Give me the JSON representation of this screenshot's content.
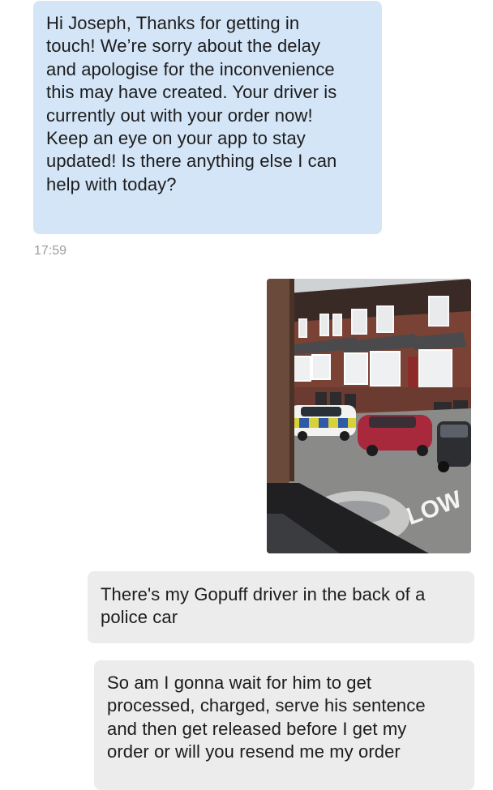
{
  "conversation": {
    "messages": [
      {
        "direction": "incoming",
        "lines": [
          "Hi Joseph, Thanks for getting in",
          "touch! We’re sorry about the delay",
          "and apologise for the inconvenience",
          "this may have created. Your driver is",
          "currently out with your order now!",
          "Keep an eye on your app to stay",
          "updated! Is there anything else I can",
          "help with today?"
        ]
      },
      {
        "direction": "outgoing",
        "lines": [
          "There's my Gopuff driver in the back of a",
          "police car"
        ]
      },
      {
        "direction": "outgoing",
        "lines": [
          "So am I gonna wait for him to get",
          "processed, charged, serve his sentence",
          "and then get released before I get my",
          "order or will you resend me my order"
        ]
      }
    ],
    "timestamp": "17:59",
    "photo": {
      "road_marking": "SLOW",
      "colors": {
        "incoming_bubble": "#d3e5f6",
        "outgoing_bubble": "#ececec",
        "police_livery_yellow": "#d8d23a",
        "police_livery_blue": "#2f5aa8",
        "red_car": "#a8283c",
        "brick": "#7a4234"
      }
    }
  }
}
